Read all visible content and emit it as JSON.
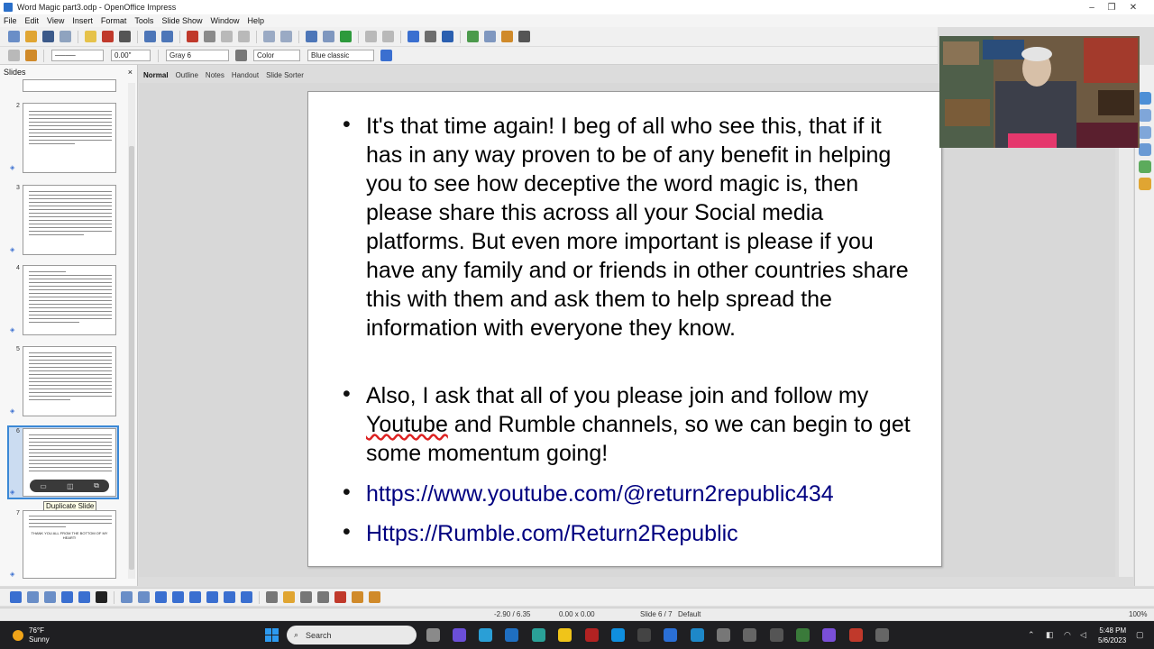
{
  "window": {
    "title": "Word Magic part3.odp - OpenOffice Impress",
    "controls": [
      "–",
      "❐",
      "✕"
    ]
  },
  "menubar": [
    "File",
    "Edit",
    "View",
    "Insert",
    "Format",
    "Tools",
    "Slide Show",
    "Window",
    "Help"
  ],
  "toolbar2": {
    "line_width": "0.00\"",
    "line_color": "Gray 6",
    "area_style": "Color",
    "area_color": "Blue classic"
  },
  "slides_panel": {
    "header": "Slides",
    "close": "×",
    "thumbnails": [
      {
        "number": "2"
      },
      {
        "number": "3"
      },
      {
        "number": "4"
      },
      {
        "number": "5"
      },
      {
        "number": "6"
      },
      {
        "number": "7"
      }
    ],
    "thumb_last_text": "THANK YOU ALL FROM THE BOTTOM OF MY HEART!",
    "tooltip": "Duplicate Slide"
  },
  "view_tabs": [
    "Normal",
    "Outline",
    "Notes",
    "Handout",
    "Slide Sorter"
  ],
  "slide": {
    "para1": "It's that time again! I beg of all who see this, that if it has in any way proven to be of any benefit in helping you to see how deceptive the word magic is, then please share this across all your Social media platforms. But even more important is please if you have any family and or friends in other countries share this with them and ask them to help spread the information with everyone they know.",
    "para2_a": "Also, I ask that all of you please join and follow my ",
    "para2_b": "Youtube",
    "para2_c": " and Rumble channels, so we can begin to get some momentum going!",
    "link1": "https://www.youtube.com/@return2republic434",
    "link2": "Https://Rumble.com/Return2Republic",
    "bullet": "•"
  },
  "statusbar": {
    "position": "-2.90 / 6.35",
    "size": "0.00 x 0.00",
    "slide": "Slide 6 / 7",
    "layout": "Default",
    "zoom": "100%"
  },
  "taskbar": {
    "weather_temp": "76°F",
    "weather_desc": "Sunny",
    "search": "Search",
    "time": "5:48 PM",
    "date": "5/6/2023"
  },
  "colors": {
    "link": "#000080",
    "selection": "#3b88d6",
    "taskbar": "#1f1f22"
  }
}
